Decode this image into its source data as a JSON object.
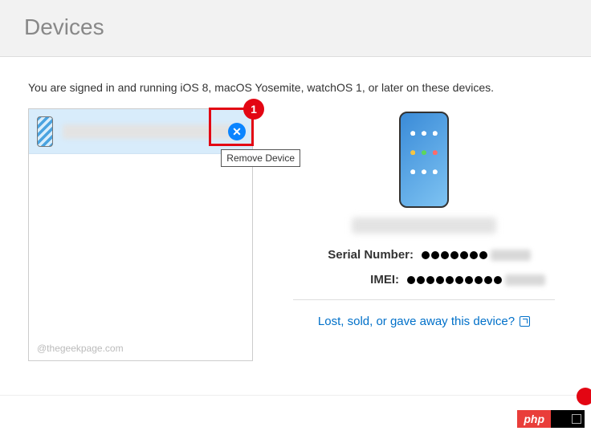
{
  "header": {
    "title": "Devices"
  },
  "intro": "You are signed in and running iOS 8, macOS Yosemite, watchOS 1, or later on these devices.",
  "device_list": {
    "items": [
      {
        "name_hidden": true
      }
    ],
    "watermark": "@thegeekpage.com"
  },
  "annotation": {
    "badge": "1",
    "tooltip": "Remove Device"
  },
  "detail": {
    "serial_label": "Serial Number:",
    "imei_label": "IMEI:",
    "lost_link": "Lost, sold, or gave away this device?"
  },
  "footer": {
    "brand": "php"
  }
}
